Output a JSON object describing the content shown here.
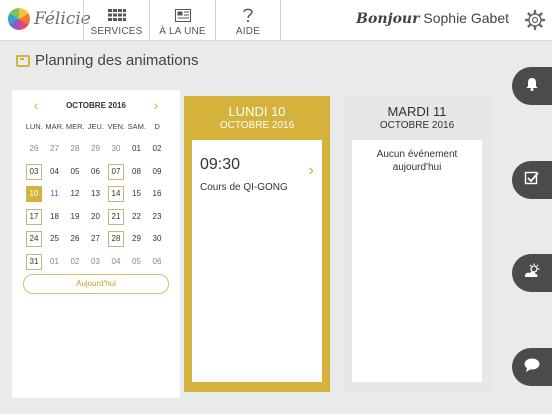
{
  "app": {
    "name": "Félicie"
  },
  "nav": [
    {
      "label": "SERVICES",
      "icon": "grid-icon"
    },
    {
      "label": "À LA UNE",
      "icon": "newspaper-icon"
    },
    {
      "label": "AIDE",
      "icon": "question-icon"
    }
  ],
  "user": {
    "greeting": "Bonjour",
    "name": "Sophie Gabet"
  },
  "page": {
    "title": "Planning des animations"
  },
  "calendar": {
    "month": "OCTOBRE 2016",
    "weekdays": [
      "LUN.",
      "MAR.",
      "MER.",
      "JEU.",
      "VEN.",
      "SAM.",
      "D"
    ],
    "today_label": "Aujourd'hui",
    "days": [
      [
        "26",
        "27",
        "28",
        "29",
        "30",
        "01",
        "02"
      ],
      [
        "03",
        "04",
        "05",
        "06",
        "07",
        "08",
        "09"
      ],
      [
        "10",
        "11",
        "12",
        "13",
        "14",
        "15",
        "16"
      ],
      [
        "17",
        "18",
        "19",
        "20",
        "21",
        "22",
        "23"
      ],
      [
        "24",
        "25",
        "26",
        "27",
        "28",
        "29",
        "30"
      ],
      [
        "31",
        "01",
        "02",
        "03",
        "04",
        "05",
        "06"
      ]
    ]
  },
  "columns": [
    {
      "day": "LUNDI 10",
      "month": "OCTOBRE 2016",
      "event": {
        "time": "09:30",
        "title": "Cours de QI-GONG"
      }
    },
    {
      "day": "MARDI 11",
      "month": "OCTOBRE 2016",
      "empty": "Aucun événement aujourd'hui"
    }
  ],
  "side_tabs": [
    "bell-icon",
    "checklist-icon",
    "weather-icon",
    "chat-icon"
  ]
}
